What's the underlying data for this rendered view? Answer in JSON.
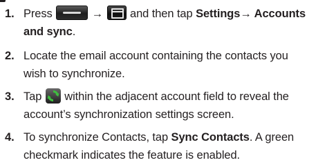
{
  "steps": [
    {
      "number": "1.",
      "press": "Press",
      "home_key_icon": "home-key-icon",
      "arrow1": "→",
      "menu_key_icon": "menu-key-icon",
      "mid": "and then tap",
      "settings": "Settings→ Accounts",
      "line2_bold": "and sync",
      "line2_end": "."
    },
    {
      "number": "2.",
      "line1": "Locate the email account containing the contacts you",
      "line2": "wish to synchronize."
    },
    {
      "number": "3.",
      "tap": "Tap",
      "sync_icon": "sync-icon",
      "line1_rest": "within the adjacent account field to reveal the",
      "line2": "account’s synchronization settings screen."
    },
    {
      "number": "4.",
      "line1_start": "To synchronize Contacts, tap",
      "line1_bold": "Sync Contacts",
      "line1_end": ". A green",
      "line2": "checkmark indicates the feature is enabled."
    }
  ],
  "colors": {
    "text": "#231f20",
    "sync_green": "#3fbf3f"
  }
}
